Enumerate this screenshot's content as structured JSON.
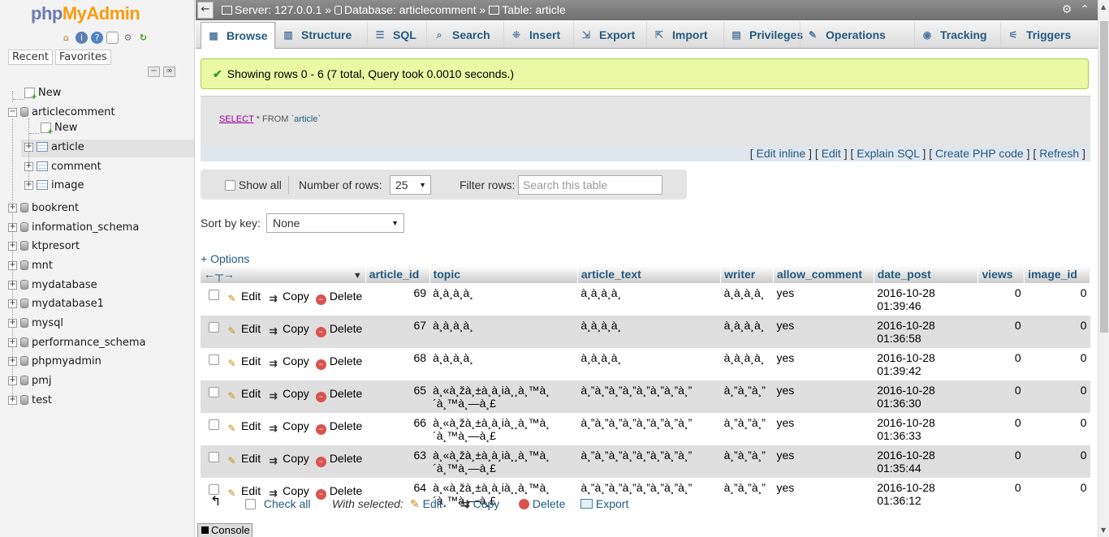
{
  "logo": {
    "php": "php",
    "myadmin": "MyAdmin"
  },
  "left_tabs": {
    "recent": "Recent",
    "favorites": "Favorites"
  },
  "tree": {
    "new_root": "New",
    "articlecomment": "articlecomment",
    "ac_new": "New",
    "article": "article",
    "comment": "comment",
    "image": "image",
    "databases": [
      "bookrent",
      "information_schema",
      "ktpresort",
      "mnt",
      "mydatabase",
      "mydatabase1",
      "mysql",
      "performance_schema",
      "phpmyadmin",
      "pmj",
      "test"
    ]
  },
  "breadcrumb": {
    "server": "Server: 127.0.0.1",
    "database": "Database: articlecomment",
    "table": "Table: article",
    "sep": "»"
  },
  "tabs": [
    {
      "label": "Browse",
      "icon": "browse-icon"
    },
    {
      "label": "Structure",
      "icon": "structure-icon"
    },
    {
      "label": "SQL",
      "icon": "sql-icon"
    },
    {
      "label": "Search",
      "icon": "search-icon"
    },
    {
      "label": "Insert",
      "icon": "insert-icon"
    },
    {
      "label": "Export",
      "icon": "export-icon"
    },
    {
      "label": "Import",
      "icon": "import-icon"
    },
    {
      "label": "Privileges",
      "icon": "privileges-icon"
    },
    {
      "label": "Operations",
      "icon": "operations-icon"
    },
    {
      "label": "Tracking",
      "icon": "tracking-icon"
    },
    {
      "label": "Triggers",
      "icon": "triggers-icon"
    }
  ],
  "success_message": "Showing rows 0 - 6 (7 total, Query took 0.0010 seconds.)",
  "sql": {
    "select": "SELECT",
    "star_from": " * FROM ",
    "table": "`article`"
  },
  "sql_links": {
    "edit_inline": "Edit inline",
    "edit": "Edit",
    "explain": "Explain SQL",
    "php": "Create PHP code",
    "refresh": "Refresh"
  },
  "navbar": {
    "show_all": "Show all",
    "number_of_rows": "Number of rows:",
    "rows_value": "25",
    "filter_rows": "Filter rows:",
    "filter_placeholder": "Search this table"
  },
  "sort": {
    "label": "Sort by key:",
    "value": "None"
  },
  "options_label": "+ Options",
  "columns": [
    "article_id",
    "topic",
    "article_text",
    "writer",
    "allow_comment",
    "date_post",
    "views",
    "image_id"
  ],
  "actions": {
    "edit": "Edit",
    "copy": "Copy",
    "delete": "Delete"
  },
  "rows": [
    {
      "article_id": "69",
      "topic": "à¸à¸à¸à¸",
      "article_text": "à¸à¸à¸à¸",
      "writer": "à¸à¸à¸à¸",
      "allow_comment": "yes",
      "date_post": "2016-10-28 01:39:46",
      "views": "0",
      "image_id": "0"
    },
    {
      "article_id": "67",
      "topic": "à¸à¸à¸à¸",
      "article_text": "à¸à¸à¸à¸",
      "writer": "à¸à¸à¸à¸",
      "allow_comment": "yes",
      "date_post": "2016-10-28 01:36:58",
      "views": "0",
      "image_id": "0"
    },
    {
      "article_id": "68",
      "topic": "à¸à¸à¸à¸",
      "article_text": "à¸à¸à¸à¸",
      "writer": "à¸à¸à¸à¸",
      "allow_comment": "yes",
      "date_post": "2016-10-28 01:39:42",
      "views": "0",
      "image_id": "0"
    },
    {
      "article_id": "65",
      "topic": "à¸«à¸žà¸±à¸à¸ià¸¸à¸™à¸ ´à¸™à¸—à¸£",
      "article_text": "à¸”à¸”à¸”à¸”à¸”à¸”à¸”à¸”",
      "writer": "à¸”à¸”à¸”",
      "allow_comment": "yes",
      "date_post": "2016-10-28 01:36:30",
      "views": "0",
      "image_id": "0"
    },
    {
      "article_id": "66",
      "topic": "à¸«à¸žà¸±à¸à¸ià¸¸à¸™à¸ ´à¸™à¸—à¸£",
      "article_text": "à¸”à¸”à¸”à¸”à¸”à¸”à¸”à¸”",
      "writer": "à¸”à¸”à¸”",
      "allow_comment": "yes",
      "date_post": "2016-10-28 01:36:33",
      "views": "0",
      "image_id": "0"
    },
    {
      "article_id": "63",
      "topic": "à¸«à¸žà¸±à¸à¸ià¸¸à¸™à¸ ´à¸™à¸—à¸£",
      "article_text": "à¸”à¸”à¸”à¸”à¸”à¸”à¸”à¸”",
      "writer": "à¸”à¸”à¸”",
      "allow_comment": "yes",
      "date_post": "2016-10-28 01:35:44",
      "views": "0",
      "image_id": "0"
    },
    {
      "article_id": "64",
      "topic": "à¸«à¸žà¸±à¸à¸ià¸¸à¸™à¸ ´à¸™à¸—à¸£",
      "article_text": "à¸”à¸”à¸”à¸”à¸”à¸”à¸”à¸”",
      "writer": "à¸”à¸”à¸”",
      "allow_comment": "yes",
      "date_post": "2016-10-28 01:36:12",
      "views": "0",
      "image_id": "0"
    }
  ],
  "bottom": {
    "check_all": "Check all",
    "with_selected": "With selected:",
    "edit": "Edit",
    "copy": "Copy",
    "delete": "Delete",
    "export": "Export"
  },
  "console_label": "Console",
  "colors": {
    "link": "#235a81",
    "success_bg": "#ebf8a4",
    "success_border": "#a2d246",
    "delete": "#d9534f"
  }
}
